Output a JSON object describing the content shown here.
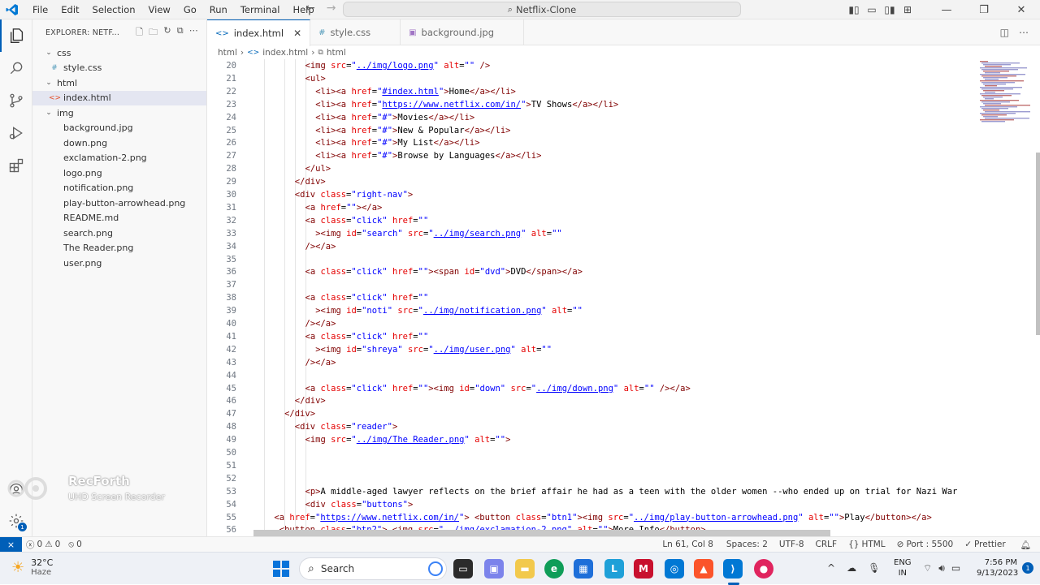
{
  "titlebar": {
    "menu": [
      "File",
      "Edit",
      "Selection",
      "View",
      "Go",
      "Run",
      "Terminal",
      "Help"
    ],
    "command_center": "Netflix-Clone"
  },
  "sidebar": {
    "header": "EXPLORER: NETF...",
    "tree": [
      {
        "label": "css",
        "type": "folder",
        "indent": 0
      },
      {
        "label": "style.css",
        "type": "css",
        "indent": 1
      },
      {
        "label": "html",
        "type": "folder",
        "indent": 0
      },
      {
        "label": "index.html",
        "type": "html",
        "indent": 1,
        "selected": true
      },
      {
        "label": "img",
        "type": "folder",
        "indent": 0
      },
      {
        "label": "background.jpg",
        "type": "file",
        "indent": 1
      },
      {
        "label": "down.png",
        "type": "file",
        "indent": 1
      },
      {
        "label": "exclamation-2.png",
        "type": "file",
        "indent": 1
      },
      {
        "label": "logo.png",
        "type": "file",
        "indent": 1
      },
      {
        "label": "notification.png",
        "type": "file",
        "indent": 1
      },
      {
        "label": "play-button-arrowhead.png",
        "type": "file",
        "indent": 1
      },
      {
        "label": "README.md",
        "type": "file",
        "indent": 1
      },
      {
        "label": "search.png",
        "type": "file",
        "indent": 1
      },
      {
        "label": "The Reader.png",
        "type": "file",
        "indent": 1
      },
      {
        "label": "user.png",
        "type": "file",
        "indent": 1
      }
    ]
  },
  "tabs": [
    {
      "label": "index.html",
      "icon": "<>",
      "active": true
    },
    {
      "label": "style.css",
      "icon": "#",
      "active": false
    },
    {
      "label": "background.jpg",
      "icon": "img",
      "active": false
    }
  ],
  "breadcrumb": [
    "html",
    "index.html",
    "html"
  ],
  "editor": {
    "lines": [
      {
        "n": "20",
        "ind": 10,
        "src": "<img src=\"../img/logo.png\" alt=\"\" />"
      },
      {
        "n": "21",
        "ind": 10,
        "src": "<ul>"
      },
      {
        "n": "22",
        "ind": 12,
        "src": "<li><a href=\"#index.html\">Home</a></li>"
      },
      {
        "n": "23",
        "ind": 12,
        "src": "<li><a href=\"https://www.netflix.com/in/\">TV Shows</a></li>"
      },
      {
        "n": "24",
        "ind": 12,
        "src": "<li><a href=\"#\">Movies</a></li>"
      },
      {
        "n": "25",
        "ind": 12,
        "src": "<li><a href=\"#\">New & Popular</a></li>"
      },
      {
        "n": "26",
        "ind": 12,
        "src": "<li><a href=\"#\">My List</a></li>"
      },
      {
        "n": "27",
        "ind": 12,
        "src": "<li><a href=\"#\">Browse by Languages</a></li>"
      },
      {
        "n": "28",
        "ind": 10,
        "src": "</ul>"
      },
      {
        "n": "29",
        "ind": 8,
        "src": "</div>"
      },
      {
        "n": "30",
        "ind": 8,
        "src": "<div class=\"right-nav\">"
      },
      {
        "n": "31",
        "ind": 10,
        "src": "<a href=\"\"></a>"
      },
      {
        "n": "32",
        "ind": 10,
        "src": "<a class=\"click\" href=\"\""
      },
      {
        "n": "33",
        "ind": 12,
        "src": "><img id=\"search\" src=\"../img/search.png\" alt=\"\""
      },
      {
        "n": "34",
        "ind": 10,
        "src": "/></a>"
      },
      {
        "n": "35",
        "ind": 0,
        "src": ""
      },
      {
        "n": "36",
        "ind": 10,
        "src": "<a class=\"click\" href=\"\"><span id=\"dvd\">DVD</span></a>"
      },
      {
        "n": "37",
        "ind": 0,
        "src": ""
      },
      {
        "n": "38",
        "ind": 10,
        "src": "<a class=\"click\" href=\"\""
      },
      {
        "n": "39",
        "ind": 12,
        "src": "><img id=\"noti\" src=\"../img/notification.png\" alt=\"\""
      },
      {
        "n": "40",
        "ind": 10,
        "src": "/></a>"
      },
      {
        "n": "41",
        "ind": 10,
        "src": "<a class=\"click\" href=\"\""
      },
      {
        "n": "42",
        "ind": 12,
        "src": "><img id=\"shreya\" src=\"../img/user.png\" alt=\"\""
      },
      {
        "n": "43",
        "ind": 10,
        "src": "/></a>"
      },
      {
        "n": "44",
        "ind": 0,
        "src": ""
      },
      {
        "n": "45",
        "ind": 10,
        "src": "<a class=\"click\" href=\"\"><img id=\"down\" src=\"../img/down.png\" alt=\"\" /></a>"
      },
      {
        "n": "46",
        "ind": 8,
        "src": "</div>"
      },
      {
        "n": "47",
        "ind": 6,
        "src": "</div>"
      },
      {
        "n": "48",
        "ind": 8,
        "src": "<div class=\"reader\">"
      },
      {
        "n": "49",
        "ind": 10,
        "src": "<img src=\"../img/The Reader.png\" alt=\"\">"
      },
      {
        "n": "50",
        "ind": 0,
        "src": ""
      },
      {
        "n": "51",
        "ind": 0,
        "src": ""
      },
      {
        "n": "52",
        "ind": 0,
        "src": ""
      },
      {
        "n": "53",
        "ind": 10,
        "src": "<p>A middle-aged lawyer reflects on the brief affair he had as a teen with the older women --who ended up on trial for Nazi War"
      },
      {
        "n": "54",
        "ind": 10,
        "src": "<div class=\"buttons\">"
      },
      {
        "n": "55",
        "ind": 4,
        "src": "<a href=\"https://www.netflix.com/in/\"> <button class=\"btn1\"><img src=\"../img/play-button-arrowhead.png\" alt=\"\">Play</button></a>"
      },
      {
        "n": "56",
        "ind": 5,
        "src": "<button class=\"btn2\"> <img src=\"../img/exclamation-2.png\" alt=\"\">More Info</button>"
      }
    ]
  },
  "statusbar": {
    "errors": "0",
    "warnings": "0",
    "ports_count": "0",
    "cursor": "Ln 61, Col 8",
    "spaces": "Spaces: 2",
    "encoding": "UTF-8",
    "eol": "CRLF",
    "language": "HTML",
    "port": "Port : 5500",
    "formatter": "Prettier"
  },
  "watermark": {
    "title": "RecForth",
    "subtitle": "UHD Screen Recorder"
  },
  "taskbar": {
    "weather_temp": "32°C",
    "weather_desc": "Haze",
    "search_placeholder": "Search",
    "lang_top": "ENG",
    "lang_bottom": "IN",
    "time": "7:56 PM",
    "date": "9/13/2023",
    "notif_count": "1"
  },
  "colors": {
    "accent": "#005fb8",
    "tag": "#800000",
    "attr": "#e50000",
    "string": "#0000ff"
  }
}
